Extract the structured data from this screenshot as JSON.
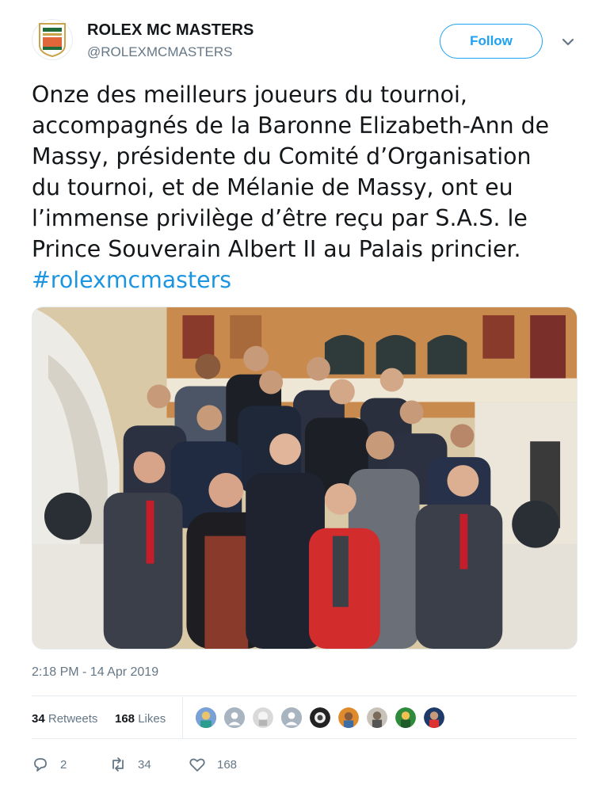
{
  "account": {
    "display_name": "ROLEX MC MASTERS",
    "handle": "@ROLEXMCMASTERS",
    "avatar_icon": "rolex-mc-masters-logo",
    "follow_label": "Follow"
  },
  "tweet": {
    "text": "Onze des meilleurs joueurs du tournoi,\naccompagnés de la Baronne Elizabeth-Ann de\nMassy, présidente du Comité d’Organisation\ndu tournoi, et de Mélanie de Massy, ont eu\nl’immense privilège d’être reçu par S.A.S. le\nPrince Souverain Albert II au Palais princier.",
    "hashtag": "#rolexmcmasters",
    "timestamp": "2:18 PM - 14 Apr 2019"
  },
  "stats": {
    "retweets_count": "34",
    "retweets_label": "Retweets",
    "likes_count": "168",
    "likes_label": "Likes"
  },
  "actions": {
    "replies": "2",
    "retweets": "34",
    "likes": "168"
  },
  "colors": {
    "accent": "#1da1f2",
    "hashtag": "#1b95e0",
    "muted": "#657786",
    "text": "#14171a"
  }
}
